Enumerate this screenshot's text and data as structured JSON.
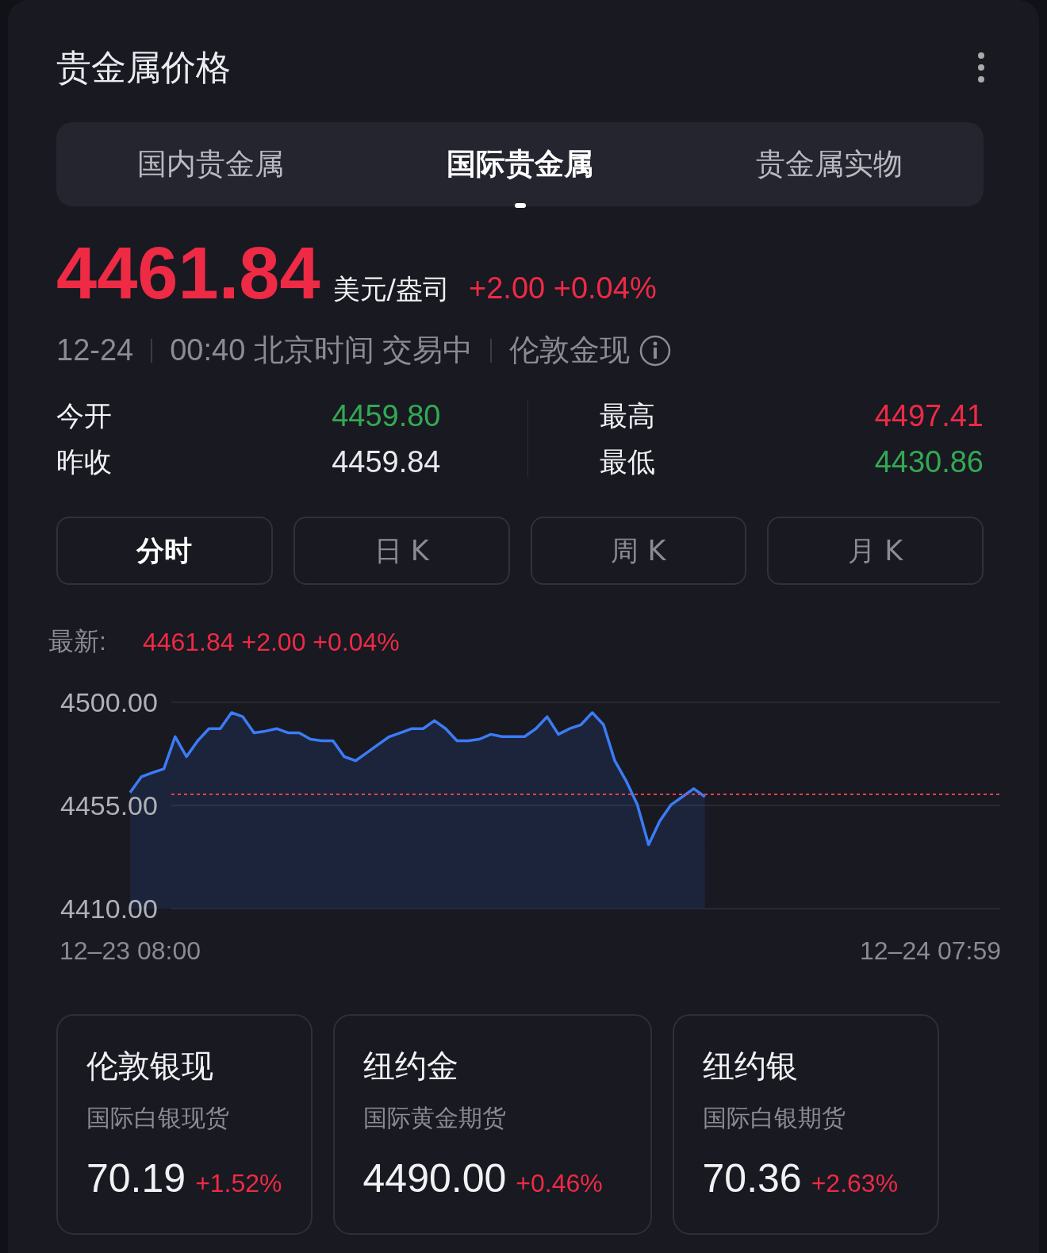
{
  "title": "贵金属价格",
  "tabs": [
    {
      "label": "国内贵金属",
      "selected": false
    },
    {
      "label": "国际贵金属",
      "selected": true
    },
    {
      "label": "贵金属实物",
      "selected": false
    }
  ],
  "quote": {
    "price": "4461.84",
    "unit": "美元/盎司",
    "change": "+2.00 +0.04%",
    "color": "#ee2a45",
    "date": "12-24",
    "time": "00:40 北京时间 交易中",
    "market": "伦敦金现"
  },
  "stats": [
    {
      "label": "今开",
      "value": "4459.80",
      "color": "#34a853"
    },
    {
      "label": "最高",
      "value": "4497.41",
      "color": "#ee2a45"
    },
    {
      "label": "昨收",
      "value": "4459.84",
      "color": "#e9e9ee"
    },
    {
      "label": "最低",
      "value": "4430.86",
      "color": "#34a853"
    }
  ],
  "periods": [
    {
      "label": "分时",
      "selected": true
    },
    {
      "label": "日 K",
      "selected": false
    },
    {
      "label": "周 K",
      "selected": false
    },
    {
      "label": "月 K",
      "selected": false
    }
  ],
  "latest": {
    "label": "最新:",
    "value": "4461.84 +2.00 +0.04%"
  },
  "chart": {
    "chart_data": {
      "type": "area",
      "categories": [
        "12–23 08:00",
        null,
        null,
        null,
        null,
        null,
        null,
        null,
        null,
        null,
        null,
        null,
        null,
        null,
        null,
        null,
        null,
        null,
        null,
        null,
        null,
        null,
        null,
        null,
        null,
        null,
        null,
        null,
        null,
        null,
        null,
        null,
        null,
        null,
        null,
        null,
        null,
        null,
        null,
        null,
        null,
        null,
        null,
        null,
        null,
        null,
        null,
        null,
        null,
        null,
        null,
        null,
        null,
        null,
        null,
        null,
        null,
        null,
        null,
        null,
        null,
        null,
        null,
        null,
        null,
        null,
        null,
        null,
        null,
        null,
        null,
        "12–24 07:59"
      ],
      "ylim": [
        4410,
        4500
      ],
      "yticks": [
        {
          "value": 4410,
          "label": "4410.00"
        },
        {
          "value": 4455,
          "label": "4455.00"
        },
        {
          "value": 4500,
          "label": "4500.00"
        }
      ],
      "series": [
        {
          "color": "#3b7cf5",
          "values": [
            4460.6,
            4467.5,
            4469.3,
            4471.0,
            4485.0,
            4476.3,
            4483.2,
            4488.5,
            4488.5,
            4495.5,
            4493.7,
            4486.7,
            4487.4,
            4488.5,
            4486.7,
            4486.7,
            4483.9,
            4483.2,
            4483.2,
            4476.3,
            4474.5,
            4478.0,
            4481.5,
            4485.0,
            4486.7,
            4488.5,
            4488.5,
            4492.0,
            4488.5,
            4483.2,
            4483.2,
            4483.9,
            4486.0,
            4485.0,
            4485.0,
            4485.0,
            4488.5,
            4493.7,
            4486.0,
            4488.5,
            4490.2,
            4495.5,
            4490.2,
            4474.5,
            4465.8,
            4455.3,
            4437.9,
            4448.3,
            4455.3,
            4458.8,
            4462.3,
            4458.8,
            null,
            null,
            null,
            null,
            null,
            null,
            null,
            null,
            null,
            null,
            null,
            null,
            null,
            null,
            null,
            null,
            null,
            null,
            null,
            null
          ]
        }
      ],
      "ref_lines": [
        {
          "axis": "y",
          "value": 4459.84,
          "color": "#e0404f"
        }
      ]
    }
  },
  "cards": [
    {
      "name": "伦敦银现",
      "subtitle": "国际白银现货",
      "price": "70.19",
      "change": "+1.52%"
    },
    {
      "name": "纽约金",
      "subtitle": "国际黄金期货",
      "price": "4490.00",
      "change": "+0.46%"
    },
    {
      "name": "纽约银",
      "subtitle": "国际白银期货",
      "price": "70.36",
      "change": "+2.63%"
    }
  ]
}
